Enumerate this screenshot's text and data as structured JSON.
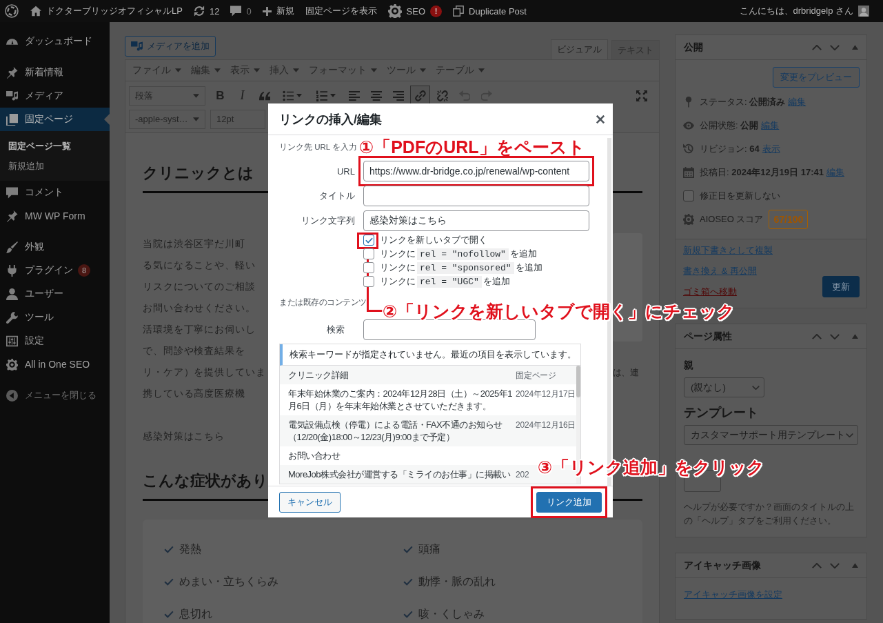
{
  "admin_bar": {
    "site_name": "ドクターブリッジオフィシャルLP",
    "updates": "12",
    "comments": "0",
    "new": "新規",
    "view_page": "固定ページを表示",
    "seo": "SEO",
    "seo_alert": "!",
    "duplicate": "Duplicate Post",
    "greeting": "こんにちは、drbridgelp さん"
  },
  "sidebar": {
    "groups": [
      {
        "items": [
          {
            "label": "ダッシュボード",
            "selected": false
          }
        ]
      },
      {
        "items": [
          {
            "label": "新着情報",
            "selected": false
          },
          {
            "label": "メディア",
            "selected": false
          },
          {
            "label": "固定ページ",
            "selected": true,
            "children": [
              {
                "label": "固定ページ一覧",
                "selected": true
              },
              {
                "label": "新規追加",
                "selected": false
              }
            ]
          },
          {
            "label": "コメント",
            "selected": false
          },
          {
            "label": "MW WP Form",
            "selected": false
          }
        ]
      },
      {
        "items": [
          {
            "label": "外観",
            "selected": false
          },
          {
            "label": "プラグイン",
            "selected": false,
            "badge": "8"
          },
          {
            "label": "ユーザー",
            "selected": false
          },
          {
            "label": "ツール",
            "selected": false
          },
          {
            "label": "設定",
            "selected": false
          },
          {
            "label": "All in One SEO",
            "selected": false
          }
        ]
      }
    ],
    "collapse": "メニューを閉じる"
  },
  "editor": {
    "add_media": "メディアを追加",
    "tabs": [
      {
        "label": "ビジュアル",
        "selected": true
      },
      {
        "label": "テキスト",
        "selected": false
      }
    ],
    "menu": [
      "ファイル",
      "編集",
      "表示",
      "挿入",
      "フォーマット",
      "ツール",
      "テーブル"
    ],
    "block_format": "段落",
    "toolbar": [
      {
        "kind": "bold",
        "label": "B",
        "active": false,
        "disabled": false
      },
      {
        "kind": "italic",
        "label": "I",
        "active": false,
        "disabled": false
      },
      {
        "kind": "quote",
        "active": false,
        "disabled": false
      },
      {
        "kind": "bullets",
        "active": false,
        "disabled": false
      },
      {
        "kind": "numbering",
        "active": false,
        "disabled": false
      },
      {
        "kind": "alignleft",
        "active": false,
        "disabled": false
      },
      {
        "kind": "aligncenter",
        "active": false,
        "disabled": false
      },
      {
        "kind": "alignright",
        "active": false,
        "disabled": false
      },
      {
        "kind": "link",
        "active": true,
        "disabled": false
      },
      {
        "kind": "unlink",
        "active": false,
        "disabled": false
      },
      {
        "kind": "undo",
        "active": false,
        "disabled": true
      },
      {
        "kind": "redo",
        "active": false,
        "disabled": true
      }
    ],
    "font_family": "-apple-syst…",
    "font_size": "12pt",
    "content": {
      "heading": "クリニックとは",
      "lines": [
        {
          "text": "当院は渋谷区宇だ川町"
        },
        {
          "text": "る気になることや、軽い"
        },
        {
          "text": "リスクについてのご相談"
        },
        {
          "text": "お問い合わせください。"
        },
        {
          "text": "活環境を丁寧にお伺いし"
        },
        {
          "text": "で、問診や検査結果を"
        },
        {
          "text": "リ・ケア）を提供していま",
          "tail": "は、連"
        },
        {
          "text": "携している高度医療機"
        }
      ],
      "link_line": "感染対策はこちら",
      "heading_2": "こんな症状があり",
      "symptoms": [
        "発熱",
        "頭痛",
        "めまい・立ちくらみ",
        "動悸・脈の乱れ",
        "息切れ",
        "咳・くしゃみ"
      ]
    }
  },
  "publish": {
    "title": "公開",
    "preview": "変更をプレビュー",
    "details": [
      {
        "text": "ステータス: **公開済み**",
        "link": "編集"
      },
      {
        "text": "公開状態: **公開**",
        "link": "編集"
      },
      {
        "text": "リビジョン: **64**",
        "link": "表示"
      },
      {
        "text": "投稿日: **2024年12月19日 17:41**",
        "link": "編集"
      }
    ],
    "keep_date": {
      "label": "修正日を更新しない",
      "checked": false
    },
    "score_label": "AIOSEO スコア",
    "score": "67/100",
    "links": [
      {
        "label": "新規下書きとして複製",
        "kind": "link"
      },
      {
        "label": "書き換え & 再公開",
        "kind": "link"
      },
      {
        "label": "ゴミ箱へ移動",
        "kind": "delete"
      }
    ],
    "update": "更新"
  },
  "page_attributes": {
    "title": "ページ属性",
    "parent_label": "親",
    "parent_value": "(親なし)",
    "template_label": "テンプレート",
    "template_value": "カスタマーサポート用テンプレート",
    "help": "ヘルプが必要ですか？画面のタイトルの上の「ヘルプ」タブをご利用ください。"
  },
  "featured_image": {
    "title": "アイキャッチ画像",
    "link": "アイキャッチ画像を設定"
  },
  "link_dialog": {
    "title": "リンクの挿入/編集",
    "instruction": "リンク先 URL を入力",
    "fields": [
      {
        "label": "URL",
        "value": "https://www.dr-bridge.co.jp/renewal/wp-content",
        "highlighted": true
      },
      {
        "label": "タイトル",
        "highlighted": false
      },
      {
        "label": "リンク文字列",
        "value": "感染対策はこちら",
        "highlighted": false
      }
    ],
    "options": [
      {
        "text": "リンクを新しいタブで開く",
        "checked": true,
        "highlighted": true
      },
      {
        "prefix": "リンクに",
        "code": "rel = \"nofollow\"",
        "suffix": "を追加",
        "checked": false,
        "highlighted": false
      },
      {
        "prefix": "リンクに",
        "code": "rel = \"sponsored\"",
        "suffix": "を追加",
        "checked": false,
        "highlighted": false
      },
      {
        "prefix": "リンクに",
        "code": "rel = \"UGC\"",
        "suffix": "を追加",
        "checked": false,
        "highlighted": false
      }
    ],
    "existing": "または既存のコンテンツ",
    "search_label": "検索",
    "notice": "検索キーワードが指定されていません。最近の項目を表示しています。",
    "results": [
      {
        "title": "クリニック詳細",
        "info": "固定ページ"
      },
      {
        "title": "年末年始休業のご案内：2024年12月28日（土）～2025年1月6日（月）を年末年始休業とさせていただきます。",
        "info": "2024年12月17日"
      },
      {
        "title": "電気設備点検（停電）による電話・FAX不通のお知らせ（12/20(金)18:00～12/23(月)9:00まで予定）",
        "info": "2024年12月16日"
      },
      {
        "title": "お問い合わせ"
      },
      {
        "title": "MoreJob株式会社が運営する「ミライのお仕事」に掲載い",
        "info": "202"
      }
    ],
    "cancel": {
      "label": "キャンセル",
      "highlighted": false
    },
    "submit": {
      "label": "リンク追加",
      "highlighted": true
    }
  },
  "annotations": [
    {
      "text": "①「PDFのURL」をペースト"
    },
    {
      "text": "②「リンクを新しいタブで開く」にチェック"
    },
    {
      "text": "③「リンク追加」をクリック"
    }
  ]
}
